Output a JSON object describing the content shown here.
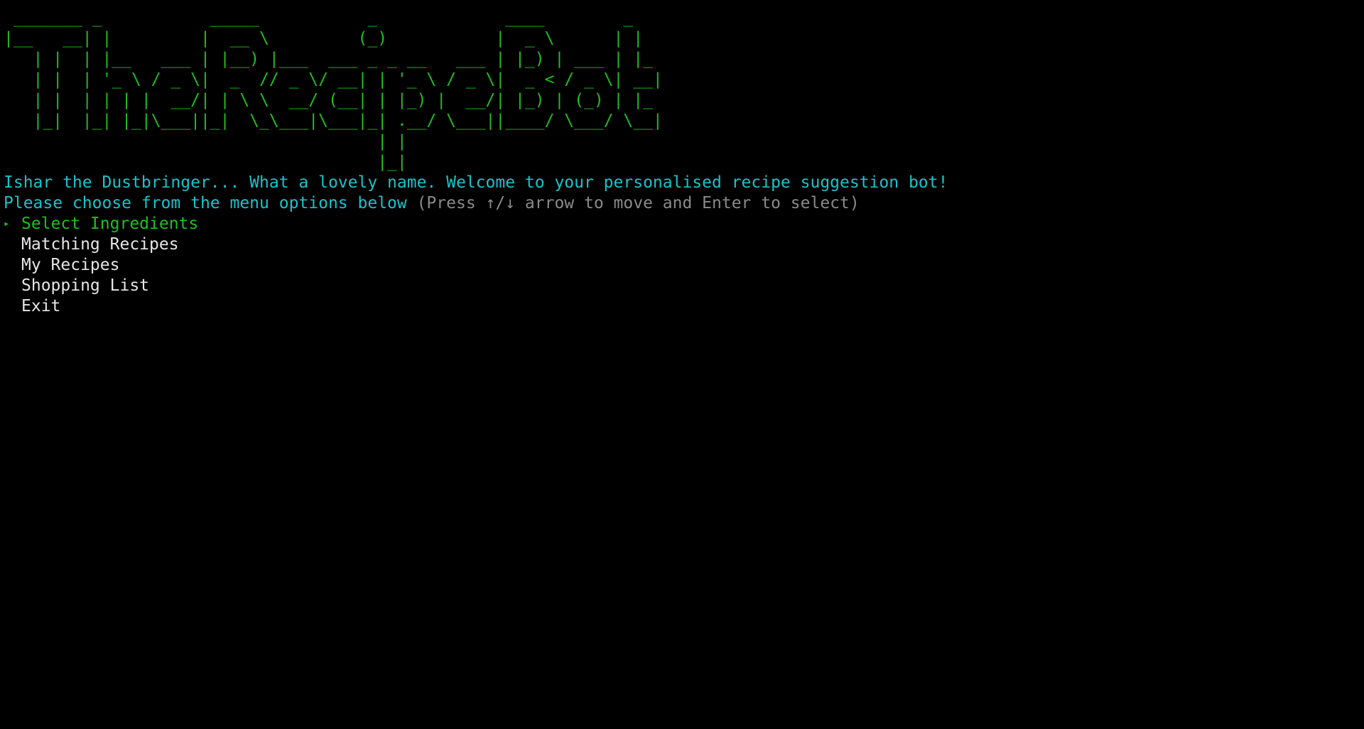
{
  "banner": {
    "ascii_art": " _______ _           _____           _             ____        _   \n|__   __| |         |  __ \\         (_)           |  _ \\      | |  \n   | |  | |__   ___ | |__) |___  ___ _ _ __   ___ | |_) | ___ | |_ \n   | |  | '_ \\ / _ \\|  _  // _ \\/ __| | '_ \\ / _ \\|  _ < / _ \\| __|\n   | |  | | | |  __/| | \\ \\  __/ (__| | |_) |  __/| |_) | (_) | |_ \n   |_|  |_| |_|\\___||_|  \\_\\___|\\___|_| .__/ \\___||____/ \\___/ \\__|\n                                      | |                         \n                                      |_|                         "
  },
  "welcome_message": "Ishar the Dustbringer... What a lovely name. Welcome to your personalised recipe suggestion bot!",
  "prompt": {
    "text": "Please choose from the menu options below",
    "hint": " (Press ↑/↓ arrow to move and Enter to select)"
  },
  "menu": {
    "pointer": "▸",
    "items": [
      {
        "label": "Select Ingredients",
        "selected": true
      },
      {
        "label": "Matching Recipes",
        "selected": false
      },
      {
        "label": "My Recipes",
        "selected": false
      },
      {
        "label": "Shopping List",
        "selected": false
      },
      {
        "label": "Exit",
        "selected": false
      }
    ]
  },
  "colors": {
    "background": "#000000",
    "banner_green": "#1fbf1f",
    "welcome_cyan": "#18c3cc",
    "hint_gray": "#8a8a8a",
    "menu_text": "#e6e6e6",
    "selected_green": "#1fbf1f"
  }
}
